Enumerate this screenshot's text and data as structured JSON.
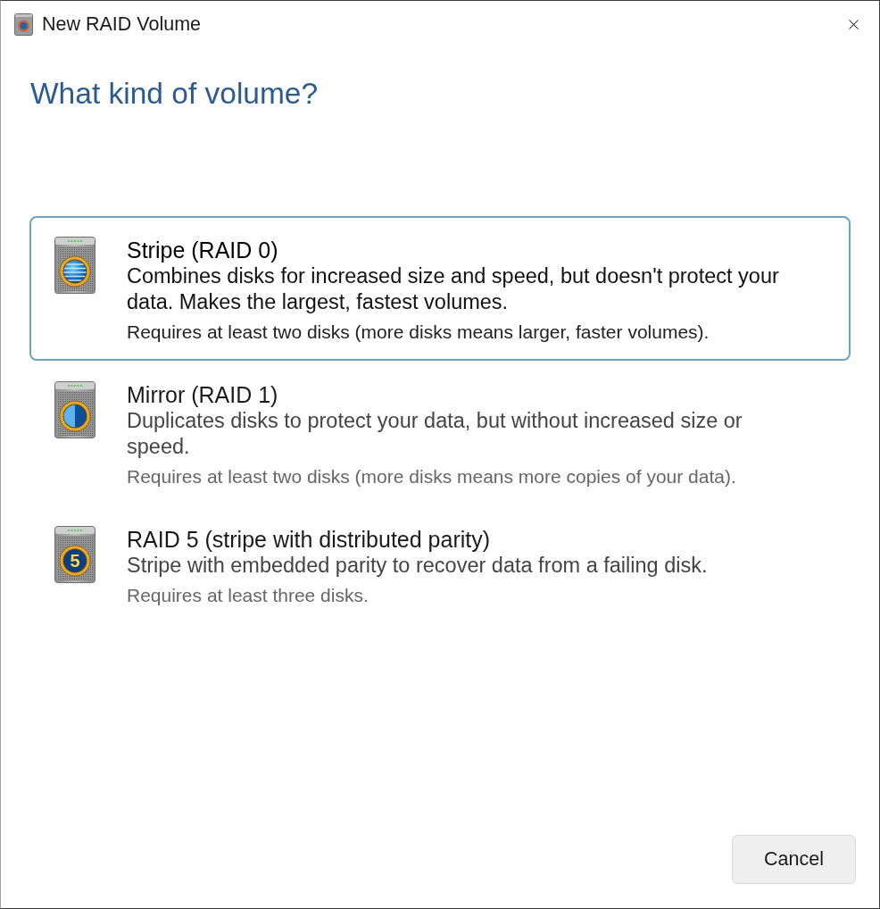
{
  "window": {
    "title": "New RAID Volume"
  },
  "heading": "What kind of volume?",
  "options": [
    {
      "kind": "stripe",
      "title": "Stripe (RAID 0)",
      "description": "Combines disks for increased size and speed, but doesn't protect your data. Makes the largest, fastest volumes.",
      "requirement": "Requires at least two disks (more disks means larger, faster volumes).",
      "selected": true
    },
    {
      "kind": "mirror",
      "title": "Mirror (RAID 1)",
      "description": "Duplicates disks to protect your data, but without increased size or speed.",
      "requirement": "Requires at least two disks (more disks means more copies of your data).",
      "selected": false
    },
    {
      "kind": "parity",
      "icon_text": "5",
      "title": "RAID 5 (stripe with distributed parity)",
      "description": "Stripe with embedded parity to recover data from a failing disk.",
      "requirement": "Requires at least three disks.",
      "selected": false
    }
  ],
  "buttons": [
    {
      "label": "Cancel"
    }
  ]
}
